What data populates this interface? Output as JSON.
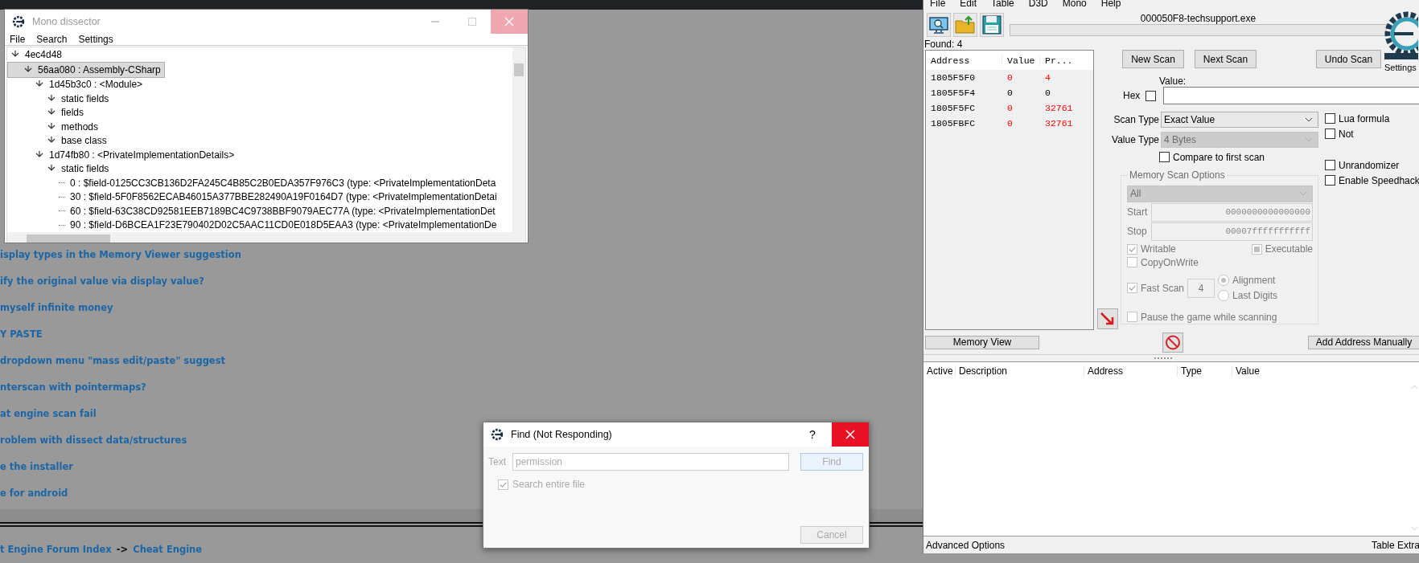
{
  "forum": {
    "topics": [
      "isplay types in the Memory Viewer suggestion",
      "ify the original value via display value?",
      "myself infinite money",
      "Y PASTE",
      "dropdown menu \"mass edit/paste\" suggest",
      "nterscan with pointermaps?",
      "at engine scan fail",
      "roblem with dissect data/structures",
      "e the installer",
      "e for android"
    ],
    "breadcrumb": [
      {
        "text": "t Engine Forum Index",
        "kind": "link"
      },
      {
        "text": "->",
        "kind": "separator"
      },
      {
        "text": "Cheat Engine",
        "kind": "link"
      }
    ]
  },
  "mono_dissector": {
    "title": "Mono dissector",
    "menu": [
      "File",
      "Search",
      "Settings"
    ],
    "tree": [
      {
        "label": "4ec4d48",
        "kind": "node",
        "expanded": true,
        "selected": false,
        "children": [
          {
            "label": "56aa080 : Assembly-CSharp",
            "kind": "node",
            "expanded": true,
            "selected": true,
            "children": [
              {
                "label": "1d45b3c0 : <Module>",
                "kind": "node",
                "expanded": true,
                "selected": false,
                "children": [
                  {
                    "label": "static fields",
                    "kind": "node",
                    "expanded": true,
                    "selected": false
                  },
                  {
                    "label": "fields",
                    "kind": "node",
                    "expanded": true,
                    "selected": false
                  },
                  {
                    "label": "methods",
                    "kind": "node",
                    "expanded": true,
                    "selected": false
                  },
                  {
                    "label": "base class",
                    "kind": "node",
                    "expanded": true,
                    "selected": false
                  }
                ]
              },
              {
                "label": "1d74fb80 : <PrivateImplementationDetails>",
                "kind": "node",
                "expanded": true,
                "selected": false,
                "children": [
                  {
                    "label": "static fields",
                    "kind": "node",
                    "expanded": true,
                    "selected": false,
                    "children": [
                      {
                        "label": "0 : $field-0125CC3CB136D2FA245C4B85C2B0EDA357F976C3 (type: <PrivateImplementationDeta",
                        "kind": "field",
                        "selected": false
                      },
                      {
                        "label": "30 : $field-5F0F8562ECAB46015A377BBE282490A19F0164D7 (type: <PrivateImplementationDetai",
                        "kind": "field",
                        "selected": false
                      },
                      {
                        "label": "60 : $field-63C38CD92581EEB7189BC4C9738BBF9079AEC77A (type: <PrivateImplementationDet",
                        "kind": "field",
                        "selected": false
                      },
                      {
                        "label": "90 : $field-D6BCEA1F23E790402D02C5AAC11CD0E018D5EAA3 (type: <PrivateImplementationDe",
                        "kind": "field",
                        "selected": false
                      }
                    ]
                  }
                ]
              }
            ]
          }
        ]
      }
    ]
  },
  "find_dialog": {
    "title": "Find (Not Responding)",
    "help": "?",
    "text_label": "Text",
    "text_value": "permission",
    "find_button": "Find",
    "search_entire_file": {
      "label": "Search entire file",
      "checked": true
    },
    "cancel_button": "Cancel"
  },
  "cheat_engine": {
    "menu": [
      "File",
      "Edit",
      "Table",
      "D3D",
      "Mono",
      "Help"
    ],
    "process": "000050F8-techsupport.exe",
    "progress": {
      "level": 0
    },
    "settings": "Settings",
    "found": "Found: 4",
    "results": {
      "columns": [
        "Address",
        "Value",
        "Pr..."
      ],
      "rows": [
        {
          "address": "1805F5F0",
          "value": "0",
          "previous": "4",
          "changed": true
        },
        {
          "address": "1805F5F4",
          "value": "0",
          "previous": "0",
          "changed": false
        },
        {
          "address": "1805F5FC",
          "value": "0",
          "previous": "32761",
          "changed": true
        },
        {
          "address": "1805FBFC",
          "value": "0",
          "previous": "32761",
          "changed": true
        }
      ]
    },
    "new_scan": "New Scan",
    "next_scan": "Next Scan",
    "undo_scan": "Undo Scan",
    "value_label": "Value:",
    "hex": {
      "label": "Hex",
      "checked": false
    },
    "scan_type": {
      "label": "Scan Type",
      "value": "Exact Value",
      "disabled": false
    },
    "value_type": {
      "label": "Value Type",
      "value": "4 Bytes",
      "disabled": true
    },
    "compare_first": {
      "label": "Compare to first scan",
      "checked": false
    },
    "formula_options": [
      {
        "label": "Lua formula",
        "checked": false
      },
      {
        "label": "Not",
        "checked": false
      }
    ],
    "hack_options": [
      {
        "label": "Unrandomizer",
        "checked": false
      },
      {
        "label": "Enable Speedhack",
        "checked": false
      }
    ],
    "memory_options": {
      "title": "Memory Scan Options",
      "region": "All",
      "start_label": "Start",
      "start": "0000000000000000",
      "stop_label": "Stop",
      "stop": "00007fffffffffff",
      "writable": {
        "label": "Writable",
        "checked": true
      },
      "executable": {
        "label": "Executable",
        "mixed": true
      },
      "copy_on_write": {
        "label": "CopyOnWrite",
        "checked": false
      },
      "fast_scan": {
        "label": "Fast Scan",
        "checked": true,
        "value": "4"
      },
      "alignment": [
        {
          "label": "Alignment",
          "selected": true
        },
        {
          "label": "Last Digits",
          "selected": false
        }
      ],
      "pause": {
        "label": "Pause the game while scanning",
        "checked": false
      }
    },
    "memory_view": "Memory View",
    "add_address": "Add Address Manually",
    "address_list": {
      "columns": [
        "Active",
        "Description",
        "Address",
        "Type",
        "Value"
      ]
    },
    "advanced_options": "Advanced Options",
    "table_extras": "Table Extra"
  }
}
